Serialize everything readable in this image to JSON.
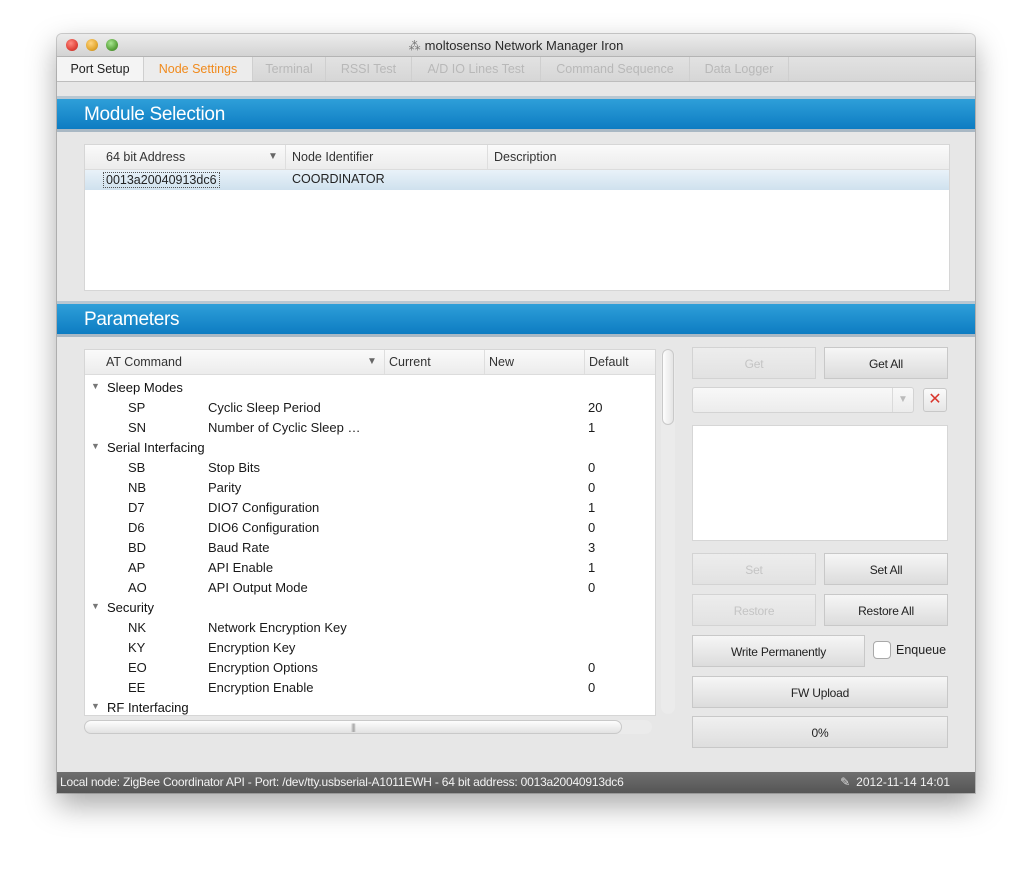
{
  "window": {
    "title": "moltosenso Network Manager Iron",
    "app_icon": "network-icon"
  },
  "tabs": [
    {
      "label": "Port Setup"
    },
    {
      "label": "Node Settings"
    },
    {
      "label": "Terminal"
    },
    {
      "label": "RSSI Test"
    },
    {
      "label": "A/D IO Lines Test"
    },
    {
      "label": "Command Sequence"
    },
    {
      "label": "Data Logger"
    }
  ],
  "module_selection": {
    "title": "Module Selection",
    "columns": [
      "64 bit Address",
      "Node Identifier",
      "Description"
    ],
    "rows": [
      {
        "address": "0013a20040913dc6",
        "node_identifier": "COORDINATOR",
        "description": ""
      }
    ]
  },
  "parameters": {
    "title": "Parameters",
    "columns": [
      "AT Command",
      "Current",
      "New",
      "Default"
    ],
    "rows": [
      {
        "group": "Sleep Modes"
      },
      {
        "cmd": "SP",
        "name": "Cyclic Sleep Period",
        "default": "20"
      },
      {
        "cmd": "SN",
        "name": "Number of Cyclic Sleep …",
        "default": "1"
      },
      {
        "group": "Serial Interfacing"
      },
      {
        "cmd": "SB",
        "name": "Stop Bits",
        "default": "0"
      },
      {
        "cmd": "NB",
        "name": "Parity",
        "default": "0"
      },
      {
        "cmd": "D7",
        "name": "DIO7 Configuration",
        "default": "1"
      },
      {
        "cmd": "D6",
        "name": "DIO6 Configuration",
        "default": "0"
      },
      {
        "cmd": "BD",
        "name": "Baud Rate",
        "default": "3"
      },
      {
        "cmd": "AP",
        "name": "API Enable",
        "default": "1"
      },
      {
        "cmd": "AO",
        "name": "API Output Mode",
        "default": "0"
      },
      {
        "group": "Security"
      },
      {
        "cmd": "NK",
        "name": "Network Encryption Key",
        "default": ""
      },
      {
        "cmd": "KY",
        "name": "Encryption Key",
        "default": ""
      },
      {
        "cmd": "EO",
        "name": "Encryption Options",
        "default": "0"
      },
      {
        "cmd": "EE",
        "name": "Encryption Enable",
        "default": "0"
      },
      {
        "group": "RF Interfacing"
      }
    ]
  },
  "actions": {
    "get": "Get",
    "get_all": "Get All",
    "set": "Set",
    "set_all": "Set All",
    "restore": "Restore",
    "restore_all": "Restore All",
    "write_permanently": "Write Permanently",
    "enqueue": "Enqueue",
    "fw_upload": "FW Upload",
    "progress": "0%",
    "progress_value": 0
  },
  "status": {
    "left": "Local node: ZigBee Coordinator API - Port: /dev/tty.usbserial-A1011EWH - 64 bit address: 0013a20040913dc6",
    "datetime": "2012-11-14 14:01",
    "pin_icon": "pin-icon"
  },
  "colors": {
    "accent": "#0d7cc2",
    "active_tab": "#f08a1c",
    "clear": "#d9362d"
  }
}
